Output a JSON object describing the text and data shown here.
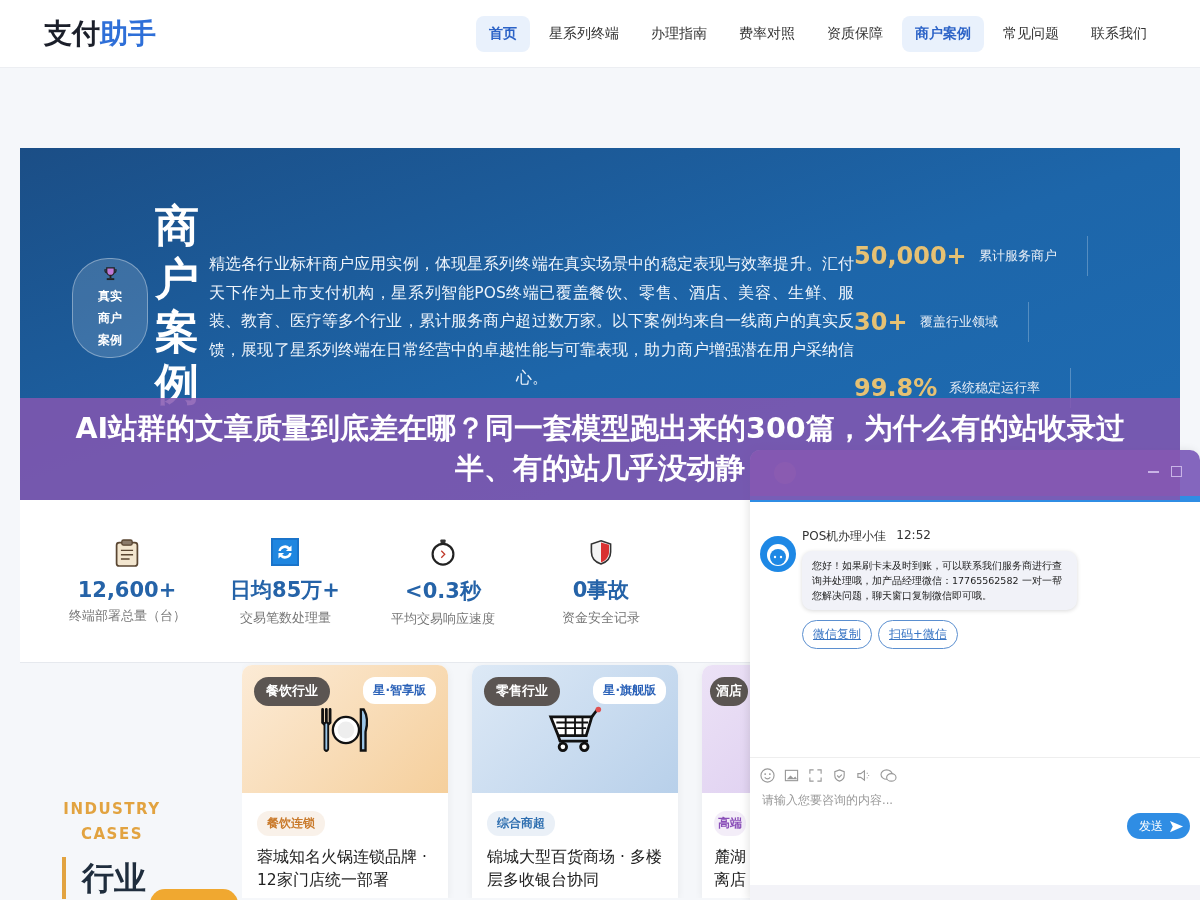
{
  "header": {
    "logo": [
      {
        "text": "支付",
        "kind": "dark"
      },
      {
        "text": "助手",
        "kind": "accent"
      }
    ],
    "nav": [
      {
        "label": "首页",
        "selected": true
      },
      {
        "label": "星系列终端",
        "selected": false
      },
      {
        "label": "办理指南",
        "selected": false
      },
      {
        "label": "费率对照",
        "selected": false
      },
      {
        "label": "资质保障",
        "selected": false
      },
      {
        "label": "商户案例",
        "selected": true
      },
      {
        "label": "常见问题",
        "selected": false
      },
      {
        "label": "联系我们",
        "selected": false
      }
    ]
  },
  "hero": {
    "badge": [
      "真实",
      "商户",
      "案例"
    ],
    "title": "商户案例",
    "description": "精选各行业标杆商户应用实例，体现星系列终端在真实场景中的稳定表现与效率提升。汇付天下作为上市支付机构，星系列智能POS终端已覆盖餐饮、零售、酒店、美容、生鲜、服装、教育、医疗等多个行业，累计服务商户超过数万家。以下案例均来自一线商户的真实反馈，展现了星系列终端在日常经营中的卓越性能与可靠表现，助力商户增强潜在用户采纳信心。",
    "stats": [
      {
        "value": "50,000+",
        "label": "累计服务商户"
      },
      {
        "value": "30+",
        "label": "覆盖行业领域"
      },
      {
        "value": "99.8%",
        "label": "系统稳定运行率"
      }
    ]
  },
  "metrics": [
    {
      "value": "12,600+",
      "label": "终端部署总量（台）"
    },
    {
      "value": "日均85万+",
      "label": "交易笔数处理量"
    },
    {
      "value": "<0.3秒",
      "label": "平均交易响应速度"
    },
    {
      "value": "0事故",
      "label": "资金安全记录"
    }
  ],
  "cases_section": {
    "eyebrow": "INDUSTRY CASES",
    "heading": "行业"
  },
  "cases": [
    {
      "industry": "餐饮行业",
      "edition": "星·智享版",
      "category": "餐饮连锁",
      "color": "#c97a2b",
      "title_lines": [
        "蓉城知名火锅连锁品牌 ·",
        "12家门店统一部署"
      ]
    },
    {
      "industry": "零售行业",
      "edition": "星·旗舰版",
      "category": "综合商超",
      "color": "#2f6fb0",
      "title_lines": [
        "锦城大型百货商场 · 多楼",
        "层多收银台协同"
      ]
    },
    {
      "industry": "酒店",
      "category": "高端",
      "color": "#8a4fb8",
      "title_lines": [
        "麓湖",
        "离店"
      ]
    }
  ],
  "banner": {
    "title": "AI站群的文章质量到底差在哪？同一套模型跑出来的300篇，为什么有的站收录过半、有的站几乎没动静"
  },
  "chat": {
    "message": {
      "sender": "POS机办理小佳",
      "time": "12:52",
      "text": "您好！如果刷卡未及时到账，可以联系我们服务商进行查询并处理哦，加产品经理微信：17765562582 一对一帮您解决问题，聊天窗口复制微信即可哦。"
    },
    "quick_replies": [
      "微信复制",
      "扫码+微信"
    ],
    "input": {
      "placeholder": "请输入您要咨询的内容..."
    },
    "send": "发送"
  }
}
